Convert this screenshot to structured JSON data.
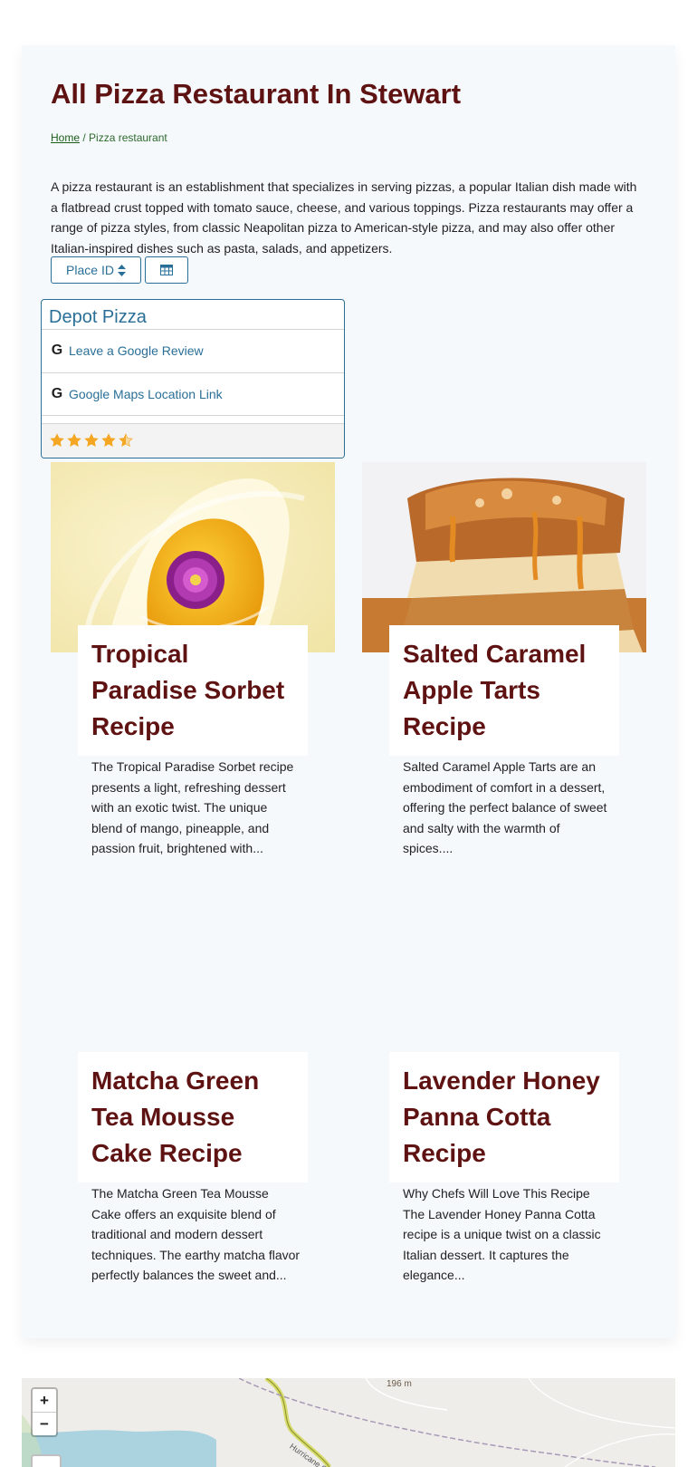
{
  "page": {
    "title": "All Pizza Restaurant In Stewart",
    "breadcrumb": {
      "home": "Home",
      "separator": " / ",
      "current": "Pizza restaurant"
    },
    "intro": "A pizza restaurant is an establishment that specializes in serving pizzas, a popular Italian dish made with a flatbread crust topped with tomato sauce, cheese, and various toppings. Pizza restaurants may offer a range of pizza styles, from classic Neapolitan pizza to American-style pizza, and may also offer other Italian-inspired dishes such as pasta, salads, and appetizers."
  },
  "toolbar": {
    "place_id_label": "Place ID",
    "place_id_icon": "sort-icon",
    "table_icon": "table-icon"
  },
  "restaurant": {
    "name": "Depot Pizza",
    "review_link": "Leave a Google Review",
    "maps_link": "Google Maps Location Link",
    "google_icon": "google-icon",
    "rating": 4.5,
    "rating_max": 5
  },
  "recipes": [
    {
      "title": "Tropical Paradise Sorbet Recipe",
      "description": "The Tropical Paradise Sorbet recipe presents a light, refreshing dessert with an exotic twist. The unique blend of mango, pineapple, and passion fruit, brightened with..."
    },
    {
      "title": "Salted Caramel Apple Tarts Recipe",
      "description": "Salted Caramel Apple Tarts are an embodiment of comfort in a dessert, offering the perfect balance of sweet and salty with the warmth of spices...."
    },
    {
      "title": "Matcha Green Tea Mousse Cake Recipe",
      "description": "The Matcha Green Tea Mousse Cake offers an exquisite blend of traditional and modern dessert techniques. The earthy matcha flavor perfectly balances the sweet and..."
    },
    {
      "title": "Lavender Honey Panna Cotta Recipe",
      "description": "Why Chefs Will Love This Recipe The Lavender Honey Panna Cotta recipe is a unique twist on a classic Italian dessert. It captures the elegance..."
    }
  ],
  "map": {
    "zoom_in": "+",
    "zoom_out": "−",
    "elevation_label": "196 m",
    "road_label": "Hurricane Cr"
  },
  "colors": {
    "title": "#5e1212",
    "link": "#2a6f97",
    "star": "#f5a623",
    "panel_bg": "#f6f9fc"
  }
}
